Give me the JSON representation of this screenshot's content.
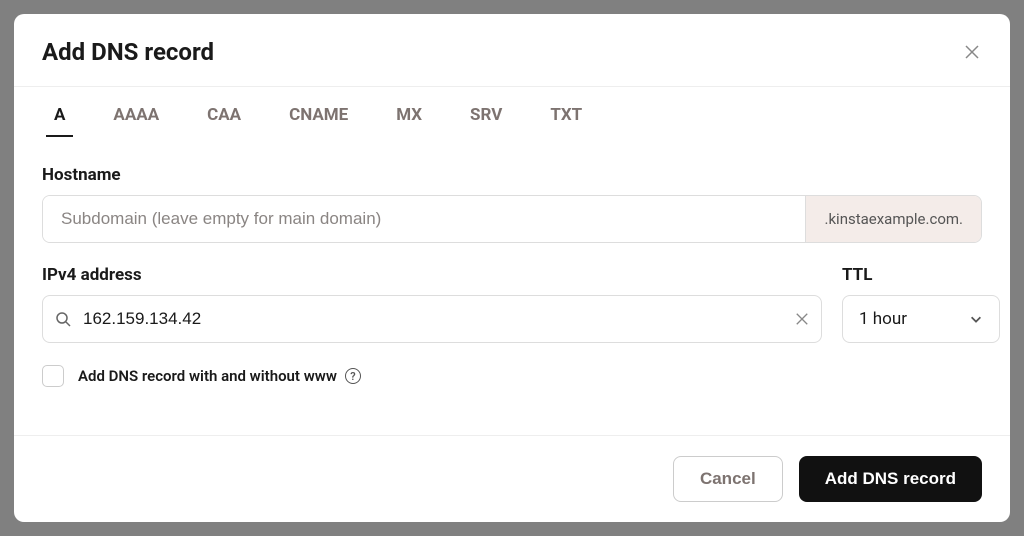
{
  "modal": {
    "title": "Add DNS record"
  },
  "tabs": [
    "A",
    "AAAA",
    "CAA",
    "CNAME",
    "MX",
    "SRV",
    "TXT"
  ],
  "activeTab": "A",
  "hostname": {
    "label": "Hostname",
    "placeholder": "Subdomain (leave empty for main domain)",
    "value": "",
    "suffix": ".kinstaexample.com."
  },
  "ip": {
    "label": "IPv4 address",
    "value": "162.159.134.42"
  },
  "ttl": {
    "label": "TTL",
    "value": "1 hour"
  },
  "www_checkbox": {
    "label": "Add DNS record with and without www",
    "checked": false
  },
  "buttons": {
    "cancel": "Cancel",
    "submit": "Add DNS record"
  }
}
